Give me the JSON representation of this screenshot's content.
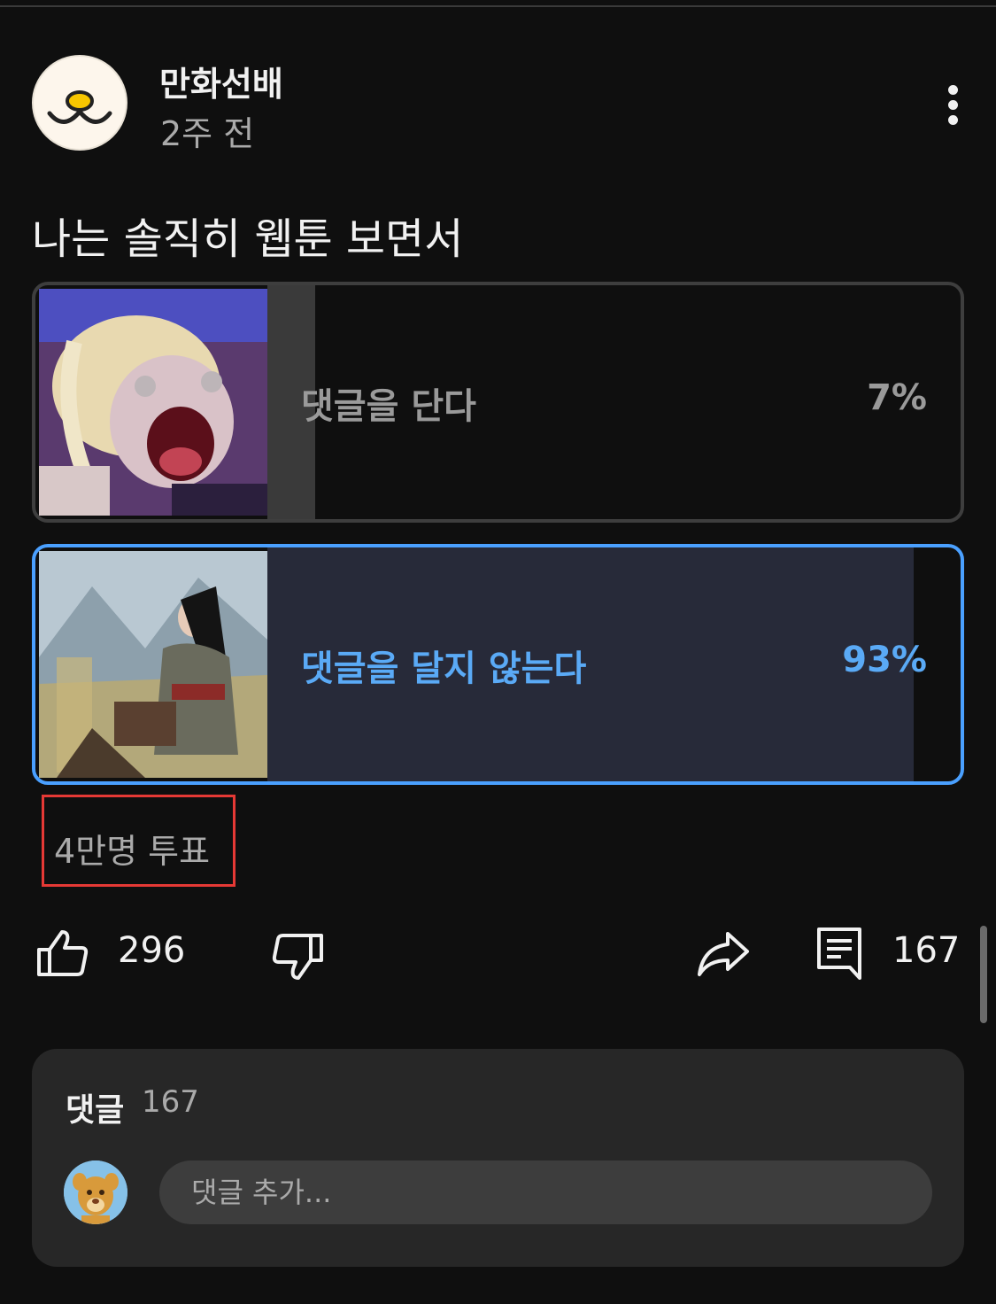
{
  "post": {
    "channel_name": "만화선배",
    "time": "2주 전",
    "text": "나는 솔직히 웹툰 보면서"
  },
  "poll": {
    "options": [
      {
        "label": "댓글을 단다",
        "percent_text": "7%",
        "percent": 7,
        "selected": false,
        "image_icon": "webtoon-scream-image"
      },
      {
        "label": "댓글을 달지 않는다",
        "percent_text": "93%",
        "percent": 93,
        "selected": true,
        "image_icon": "webtoon-warrior-image"
      }
    ],
    "vote_count": "4만명 투표"
  },
  "actions": {
    "like_count": "296",
    "comment_count": "167",
    "icons": [
      "thumbs-up-icon",
      "thumbs-down-icon",
      "share-icon",
      "comment-icon"
    ]
  },
  "comments": {
    "title": "댓글",
    "count": "167",
    "placeholder": "댓글 추가..."
  },
  "colors": {
    "background": "#0f0f0f",
    "accent": "#4aa0ff",
    "selected_fill": "#272a39",
    "highlight_box": "#e53935"
  }
}
